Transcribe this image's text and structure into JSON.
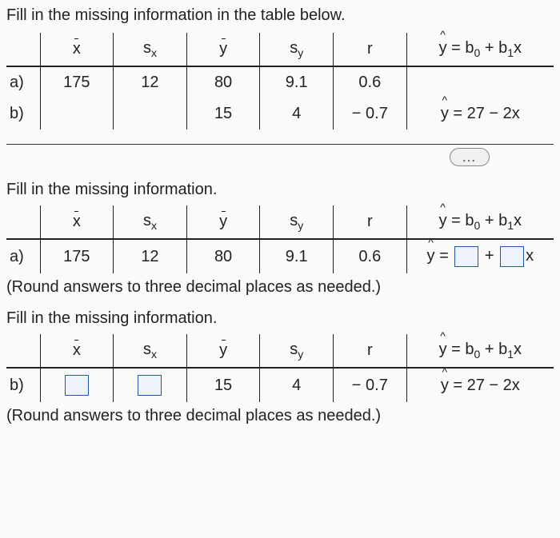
{
  "prompt_main": "Fill in the missing information in the table below.",
  "headers": {
    "xbar": "x",
    "sx": "s",
    "sx_sub": "x",
    "ybar": "y",
    "sy": "s",
    "sy_sub": "y",
    "r": "r",
    "eq_y": "y",
    "eq_rest": " = b",
    "eq_sub0": "0",
    "eq_plus": " + b",
    "eq_sub1": "1",
    "eq_x": "x"
  },
  "table1": {
    "a": {
      "label": "a)",
      "xbar": "175",
      "sx": "12",
      "ybar": "80",
      "sy": "9.1",
      "r": "0.6",
      "eq": ""
    },
    "b": {
      "label": "b)",
      "xbar": "",
      "sx": "",
      "ybar": "15",
      "sy": "4",
      "r": "− 0.7",
      "eq_y": "y",
      "eq_rest": " = 27 − 2x"
    }
  },
  "ellipsis": "…",
  "subhead_a": "Fill in the missing information.",
  "table2a": {
    "a": {
      "label": "a)",
      "xbar": "175",
      "sx": "12",
      "ybar": "80",
      "sy": "9.1",
      "r": "0.6",
      "eq_y": "y",
      "eq_eq": " = ",
      "eq_plus": " + ",
      "eq_x": "x"
    }
  },
  "round_note": "(Round answers to three decimal places as needed.)",
  "subhead_b": "Fill in the missing information.",
  "table2b": {
    "b": {
      "label": "b)",
      "ybar": "15",
      "sy": "4",
      "r": "− 0.7",
      "eq_y": "y",
      "eq_rest": " = 27 − 2x"
    }
  }
}
